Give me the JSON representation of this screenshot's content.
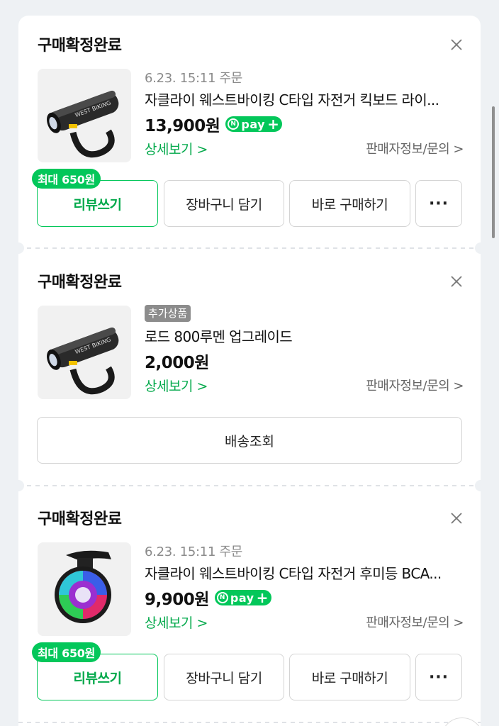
{
  "orders": [
    {
      "status": "구매확정완료",
      "order_date": "6.23. 15:11 주문",
      "product_name": "자클라이 웨스트바이킹 C타입 자전거 킥보드 라이...",
      "price": "13,900원",
      "npay": "pay",
      "detail_link": "상세보기 >",
      "seller_link": "판매자정보/문의 >",
      "reward_badge": "최대 650원",
      "buttons": {
        "review": "리뷰쓰기",
        "cart": "장바구니 담기",
        "buy": "바로 구매하기",
        "more": "···"
      },
      "icon": "bike-headlight-image"
    },
    {
      "status": "구매확정완료",
      "badge": "추가상품",
      "product_name": "로드 800루멘 업그레이드",
      "price": "2,000원",
      "detail_link": "상세보기 >",
      "seller_link": "판매자정보/문의 >",
      "buttons": {
        "tracking": "배송조회"
      },
      "icon": "bike-headlight-image"
    },
    {
      "status": "구매확정완료",
      "order_date": "6.23. 15:11 주문",
      "product_name": "자클라이 웨스트바이킹 C타입 자전거 후미등 BCA...",
      "price": "9,900원",
      "npay": "pay",
      "detail_link": "상세보기 >",
      "seller_link": "판매자정보/문의 >",
      "reward_badge": "최대 650원",
      "buttons": {
        "review": "리뷰쓰기",
        "cart": "장바구니 담기",
        "buy": "바로 구매하기",
        "more": "···"
      },
      "icon": "rgb-taillight-image"
    }
  ],
  "colors": {
    "accent": "#03c75a",
    "background": "#eef1f4",
    "badge_gray": "#8c8c8c"
  }
}
